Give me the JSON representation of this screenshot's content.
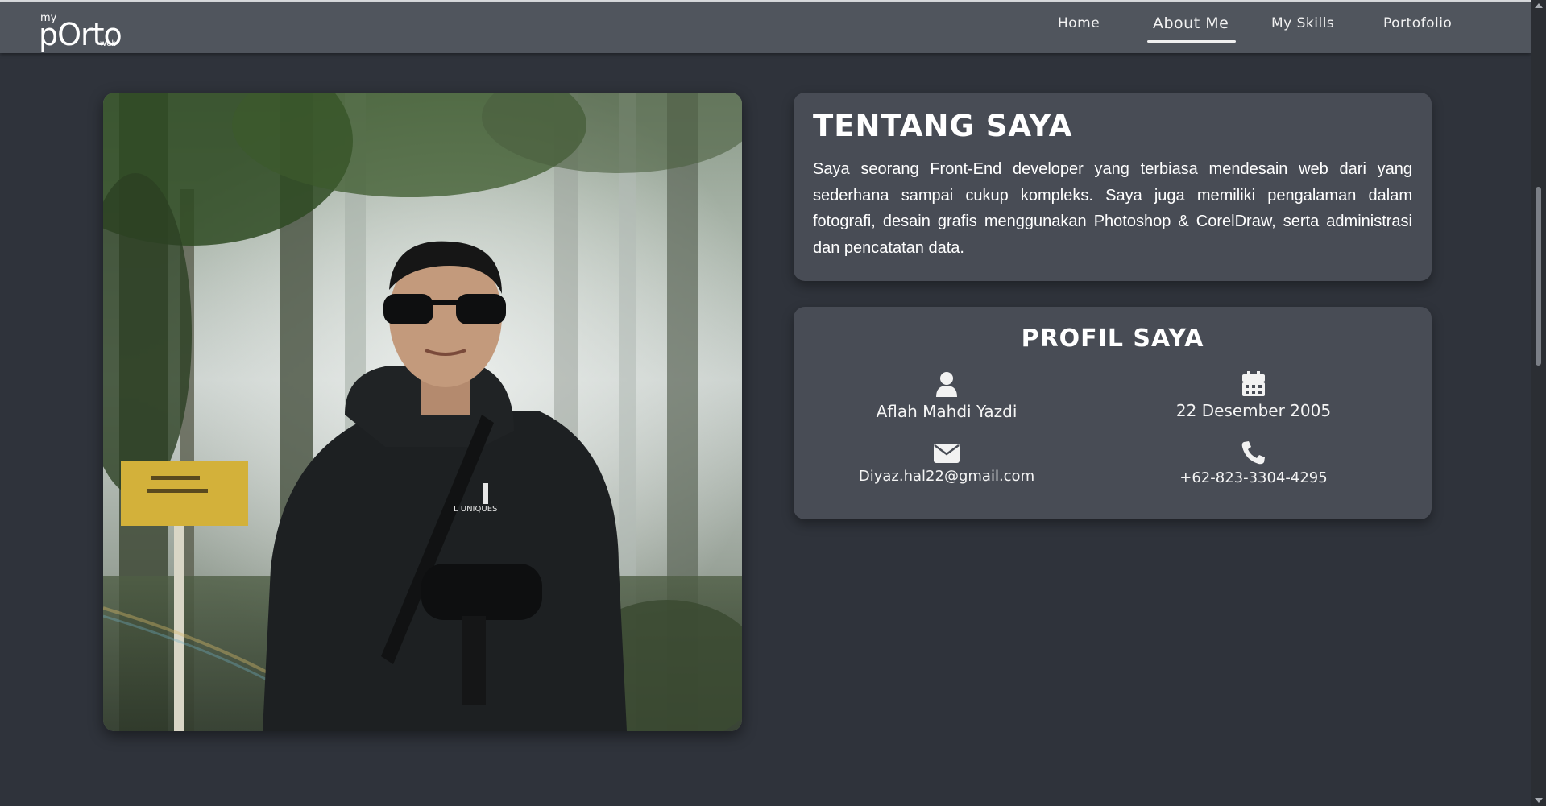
{
  "logo": {
    "my": "my",
    "main": "pOrto",
    "web": "web"
  },
  "nav": {
    "items": [
      {
        "label": "Home",
        "active": false
      },
      {
        "label": "About Me",
        "active": true
      },
      {
        "label": "My Skills",
        "active": false
      },
      {
        "label": "Portofolio",
        "active": false
      }
    ]
  },
  "about": {
    "title": "TENTANG SAYA",
    "text": "Saya seorang Front-End developer yang terbiasa mendesain web dari yang sederhana sampai cukup kompleks. Saya juga memiliki pengalaman dalam fotografi, desain grafis menggunakan Photoshop & CorelDraw, serta administrasi dan pencatatan data."
  },
  "profile": {
    "title": "PROFIL SAYA",
    "name": {
      "icon": "user-icon",
      "value": "Aflah Mahdi Yazdi"
    },
    "birthdate": {
      "icon": "calendar-icon",
      "value": "22 Desember 2005"
    },
    "email": {
      "icon": "envelope-icon",
      "value": "Diyaz.hal22@gmail.com"
    },
    "phone": {
      "icon": "phone-icon",
      "value": "+62-823-3304-4295"
    }
  },
  "colors": {
    "background": "#2f333b",
    "navbar": "#50555d",
    "card": "#484c55"
  }
}
